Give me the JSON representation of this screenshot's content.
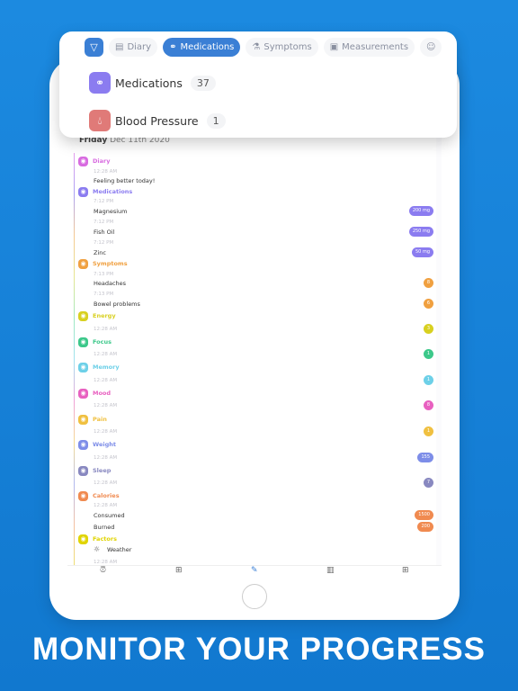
{
  "filter_bar": {
    "chips": [
      {
        "label": "Diary",
        "icon": "diary-icon"
      },
      {
        "label": "Medications",
        "icon": "pills-icon",
        "active": true
      },
      {
        "label": "Symptoms",
        "icon": "flask-icon"
      },
      {
        "label": "Measurements",
        "icon": "chart-icon"
      }
    ],
    "suggestions": [
      {
        "label": "Medications",
        "count": "37",
        "color": "#8b7cf0",
        "icon": "pills-icon"
      },
      {
        "label": "Blood Pressure",
        "count": "1",
        "color": "#e07a78",
        "icon": "drop-icon"
      }
    ]
  },
  "date": {
    "day": "Friday",
    "date": "Dec 11th 2020"
  },
  "timeline": {
    "rows": [
      {
        "kind": "header",
        "text": "Diary",
        "color": "#d86be0"
      },
      {
        "kind": "time",
        "text": "12:28 AM"
      },
      {
        "kind": "item",
        "text": "Feeling better today!"
      },
      {
        "kind": "header",
        "text": "Medications",
        "color": "#8b7cf0"
      },
      {
        "kind": "time",
        "text": "7:12 PM"
      },
      {
        "kind": "item",
        "text": "Magnesium",
        "badge": "200 mg",
        "color": "#8b7cf0"
      },
      {
        "kind": "time",
        "text": "7:12 PM"
      },
      {
        "kind": "item",
        "text": "Fish Oil",
        "badge": "250 mg",
        "color": "#8b7cf0"
      },
      {
        "kind": "time",
        "text": "7:12 PM"
      },
      {
        "kind": "item",
        "text": "Zinc",
        "badge": "50 mg",
        "color": "#8b7cf0"
      },
      {
        "kind": "header",
        "text": "Symptoms",
        "color": "#f0a040"
      },
      {
        "kind": "time",
        "text": "7:13 PM"
      },
      {
        "kind": "item",
        "text": "Headaches",
        "badge": "8",
        "color": "#f0a040"
      },
      {
        "kind": "time",
        "text": "7:13 PM"
      },
      {
        "kind": "item",
        "text": "Bowel problems",
        "badge": "6",
        "color": "#f0a040"
      },
      {
        "kind": "header",
        "text": "Energy",
        "color": "#d8d020"
      },
      {
        "kind": "time",
        "text": "12:28 AM",
        "badge": "3",
        "color": "#d8d020"
      },
      {
        "kind": "header",
        "text": "Focus",
        "color": "#3cc88a"
      },
      {
        "kind": "time",
        "text": "12:28 AM",
        "badge": "1",
        "color": "#3cc88a"
      },
      {
        "kind": "header",
        "text": "Memory",
        "color": "#6dd0e8"
      },
      {
        "kind": "time",
        "text": "12:28 AM",
        "badge": "1",
        "color": "#6dd0e8"
      },
      {
        "kind": "header",
        "text": "Mood",
        "color": "#e860c0"
      },
      {
        "kind": "time",
        "text": "12:28 AM",
        "badge": "8",
        "color": "#e860c0"
      },
      {
        "kind": "header",
        "text": "Pain",
        "color": "#f0c040"
      },
      {
        "kind": "time",
        "text": "12:28 AM",
        "badge": "1",
        "color": "#f0c040"
      },
      {
        "kind": "header",
        "text": "Weight",
        "color": "#7d8de8"
      },
      {
        "kind": "time",
        "text": "12:28 AM",
        "badge": "155",
        "color": "#7d8de8"
      },
      {
        "kind": "header",
        "text": "Sleep",
        "color": "#8888c0"
      },
      {
        "kind": "time",
        "text": "12:28 AM",
        "badge": "7",
        "color": "#8888c0"
      },
      {
        "kind": "header",
        "text": "Calories",
        "color": "#f08a50"
      },
      {
        "kind": "time",
        "text": "12:28 AM"
      },
      {
        "kind": "item",
        "text": "Consumed",
        "badge": "1500",
        "color": "#f08a50"
      },
      {
        "kind": "item",
        "text": "Burned",
        "badge": "200",
        "color": "#f08a50"
      },
      {
        "kind": "header",
        "text": "Factors",
        "color": "#e0d400"
      },
      {
        "kind": "item",
        "text": "Weather",
        "icon": "sun-icon"
      },
      {
        "kind": "time",
        "text": "12:28 AM"
      }
    ]
  },
  "tabbar": [
    {
      "icon": "alarm-icon"
    },
    {
      "icon": "add-folder-icon"
    },
    {
      "icon": "edit-icon",
      "active": true
    },
    {
      "icon": "stats-icon"
    },
    {
      "icon": "grid-icon"
    }
  ],
  "headline": "MONITOR YOUR PROGRESS",
  "colors": {
    "background": "#1178cf",
    "accent": "#3a7fd5"
  }
}
